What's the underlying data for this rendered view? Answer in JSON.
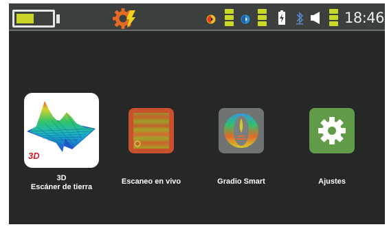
{
  "status_bar": {
    "time": "18:46",
    "battery": {
      "level": 0.5,
      "color": "#c8d524"
    },
    "icons": [
      "battery-icon",
      "device-logo-icon",
      "signal-indicator-icon",
      "signal-strength-bars",
      "signal-indicator-icon",
      "signal-strength-bars",
      "charging-icon",
      "bluetooth-icon",
      "volume-icon",
      "volume-level-bars"
    ]
  },
  "apps": [
    {
      "id": "3d",
      "badge": "3D",
      "label_line1": "3D",
      "label_line2": "Escáner de tierra",
      "icon": "terrain-3d-icon"
    },
    {
      "id": "scan",
      "label": "Escaneo en vivo",
      "icon": "live-scan-icon"
    },
    {
      "id": "gradio",
      "label": "Gradio Smart",
      "icon": "gradio-smart-icon"
    },
    {
      "id": "settings",
      "label": "Ajustes",
      "icon": "gear-icon"
    }
  ],
  "colors": {
    "background": "#252827",
    "status_bar": "#3b3f3e",
    "accent_green": "#c9d829",
    "scan_tile": "#c8502d",
    "gradio_tile": "#6f7372",
    "settings_tile": "#619b48"
  }
}
